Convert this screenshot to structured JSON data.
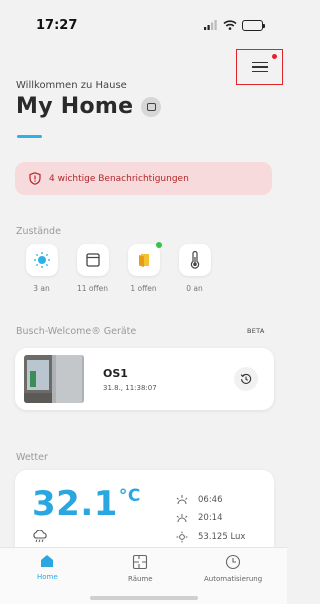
{
  "status_bar": {
    "time": "17:27"
  },
  "header": {
    "welcome": "Willkommen zu Hause",
    "title": "My Home"
  },
  "alert": {
    "text": "4 wichtige Benachrichtigungen"
  },
  "states": {
    "section_label": "Zustände",
    "items": [
      {
        "icon": "light-icon",
        "label": "3 an"
      },
      {
        "icon": "blind-icon",
        "label": "11 offen"
      },
      {
        "icon": "door-icon",
        "label": "1 offen"
      },
      {
        "icon": "thermometer-icon",
        "label": "0 an"
      }
    ]
  },
  "devices": {
    "section_label": "Busch-Welcome® Geräte",
    "beta": "BETA",
    "card": {
      "name": "OS1",
      "time": "31.8., 11:38:07"
    }
  },
  "weather": {
    "section_label": "Wetter",
    "temperature": "32.1",
    "unit": "°C",
    "sunrise": "06:46",
    "sunset": "20:14",
    "brightness": "53.125 Lux"
  },
  "nav": {
    "items": [
      {
        "label": "Home",
        "active": true
      },
      {
        "label": "Räume",
        "active": false
      },
      {
        "label": "Automatisierung",
        "active": false
      }
    ]
  },
  "colors": {
    "accent": "#2bb3e8",
    "alert_bg": "#f7dadb",
    "alert_text": "#b3262a",
    "highlight": "#e0252a"
  }
}
